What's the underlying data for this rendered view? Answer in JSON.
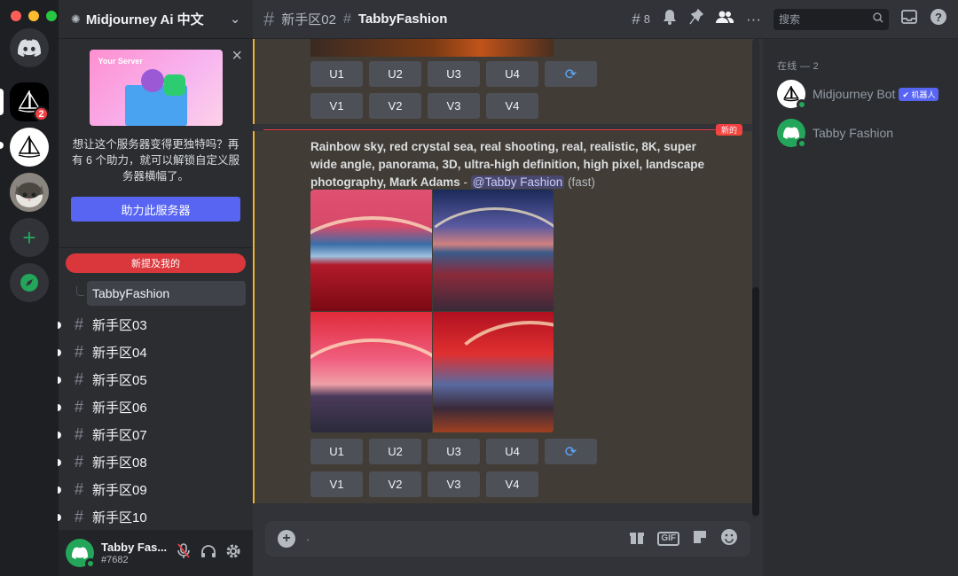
{
  "server": {
    "name": "Midjourney Ai 中文",
    "rail_badge": "2"
  },
  "boost": {
    "image_label": "Your Server",
    "text": "想让这个服务器变得更独特吗？再有 6 个助力，就可以解锁自定义服务器横幅了。",
    "button": "助力此服务器"
  },
  "sidebar": {
    "mentions_pill": "新提及我的",
    "thread": "TabbyFashion",
    "channels": [
      "新手区03",
      "新手区04",
      "新手区05",
      "新手区06",
      "新手区07",
      "新手区08",
      "新手区09",
      "新手区10"
    ]
  },
  "user": {
    "name": "Tabby Fas...",
    "tag": "#7682"
  },
  "topbar": {
    "parent_channel": "新手区02",
    "thread_title": "TabbyFashion",
    "thread_count": "8",
    "search_placeholder": "搜索"
  },
  "chat": {
    "new_marker": "新的",
    "prompt_text": "Rainbow sky, red crystal sea, real shooting, real, realistic, 8K, super wide angle, panorama, 3D, ultra-high definition, high pixel, landscape photography, Mark Adams",
    "prompt_dash": " - ",
    "mention": "@Tabby Fashion",
    "speed": "(fast)",
    "upscale_buttons": [
      "U1",
      "U2",
      "U3",
      "U4"
    ],
    "variation_buttons": [
      "V1",
      "V2",
      "V3",
      "V4"
    ],
    "composer_placeholder": "·"
  },
  "members": {
    "header": "在线 — 2",
    "list": [
      {
        "name": "Midjourney Bot",
        "tag": "机器人"
      },
      {
        "name": "Tabby Fashion",
        "tag": ""
      }
    ]
  },
  "colors": {
    "accent": "#5865f2",
    "online": "#23a55a",
    "mention_red": "#f23f42",
    "highlight_border": "#f0b232"
  }
}
